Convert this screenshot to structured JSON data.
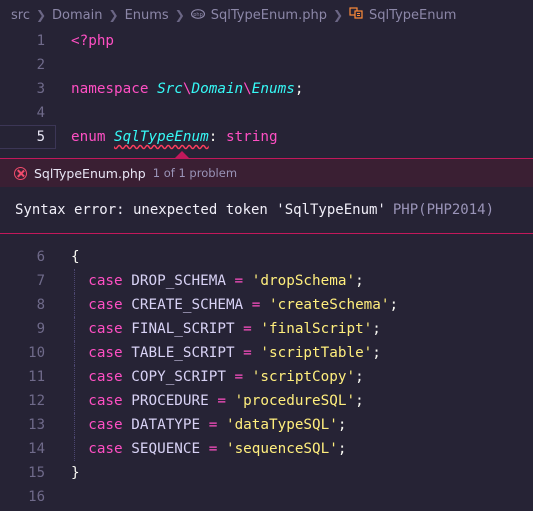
{
  "breadcrumb": {
    "items": [
      "src",
      "Domain",
      "Enums",
      "SqlTypeEnum.php",
      "SqlTypeEnum"
    ]
  },
  "editor_top": [
    {
      "n": "1",
      "tokens": [
        {
          "t": "<?php",
          "c": "tag"
        }
      ]
    },
    {
      "n": "2",
      "tokens": []
    },
    {
      "n": "3",
      "tokens": [
        {
          "t": "namespace ",
          "c": "kw"
        },
        {
          "t": "Src",
          "c": "ns"
        },
        {
          "t": "\\",
          "c": "sep"
        },
        {
          "t": "Domain",
          "c": "ns"
        },
        {
          "t": "\\",
          "c": "sep"
        },
        {
          "t": "Enums",
          "c": "ns"
        },
        {
          "t": ";",
          "c": "plain"
        }
      ]
    },
    {
      "n": "4",
      "tokens": []
    },
    {
      "n": "5",
      "active": true,
      "tokens": [
        {
          "t": "enum ",
          "c": "kw"
        },
        {
          "t": "SqlTypeEnum",
          "c": "cls squig"
        },
        {
          "t": ":",
          "c": "plain"
        },
        {
          "t": " string",
          "c": "type"
        }
      ]
    }
  ],
  "problem_peek": {
    "file": "SqlTypeEnum.php",
    "count": "1 of 1 problem",
    "message": "Syntax error: unexpected token 'SqlTypeEnum'",
    "source": "PHP(PHP2014)"
  },
  "editor_bottom": [
    {
      "n": "6",
      "tokens": [
        {
          "t": "{",
          "c": "plain"
        }
      ]
    },
    {
      "n": "7",
      "guide": true,
      "tokens": [
        {
          "t": "  case ",
          "c": "kw"
        },
        {
          "t": "DROP_SCHEMA",
          "c": "const"
        },
        {
          "t": " = ",
          "c": "op"
        },
        {
          "t": "'dropSchema'",
          "c": "strg"
        },
        {
          "t": ";",
          "c": "plain"
        }
      ]
    },
    {
      "n": "8",
      "guide": true,
      "tokens": [
        {
          "t": "  case ",
          "c": "kw"
        },
        {
          "t": "CREATE_SCHEMA",
          "c": "const"
        },
        {
          "t": " = ",
          "c": "op"
        },
        {
          "t": "'createSchema'",
          "c": "strg"
        },
        {
          "t": ";",
          "c": "plain"
        }
      ]
    },
    {
      "n": "9",
      "guide": true,
      "tokens": [
        {
          "t": "  case ",
          "c": "kw"
        },
        {
          "t": "FINAL_SCRIPT",
          "c": "const"
        },
        {
          "t": " = ",
          "c": "op"
        },
        {
          "t": "'finalScript'",
          "c": "strg"
        },
        {
          "t": ";",
          "c": "plain"
        }
      ]
    },
    {
      "n": "10",
      "guide": true,
      "tokens": [
        {
          "t": "  case ",
          "c": "kw"
        },
        {
          "t": "TABLE_SCRIPT",
          "c": "const"
        },
        {
          "t": " = ",
          "c": "op"
        },
        {
          "t": "'scriptTable'",
          "c": "strg"
        },
        {
          "t": ";",
          "c": "plain"
        }
      ]
    },
    {
      "n": "11",
      "guide": true,
      "tokens": [
        {
          "t": "  case ",
          "c": "kw"
        },
        {
          "t": "COPY_SCRIPT",
          "c": "const"
        },
        {
          "t": " = ",
          "c": "op"
        },
        {
          "t": "'scriptCopy'",
          "c": "strg"
        },
        {
          "t": ";",
          "c": "plain"
        }
      ]
    },
    {
      "n": "12",
      "guide": true,
      "tokens": [
        {
          "t": "  case ",
          "c": "kw"
        },
        {
          "t": "PROCEDURE",
          "c": "const"
        },
        {
          "t": " = ",
          "c": "op"
        },
        {
          "t": "'procedureSQL'",
          "c": "strg"
        },
        {
          "t": ";",
          "c": "plain"
        }
      ]
    },
    {
      "n": "13",
      "guide": true,
      "tokens": [
        {
          "t": "  case ",
          "c": "kw"
        },
        {
          "t": "DATATYPE",
          "c": "const"
        },
        {
          "t": " = ",
          "c": "op"
        },
        {
          "t": "'dataTypeSQL'",
          "c": "strg"
        },
        {
          "t": ";",
          "c": "plain"
        }
      ]
    },
    {
      "n": "14",
      "guide": true,
      "tokens": [
        {
          "t": "  case ",
          "c": "kw"
        },
        {
          "t": "SEQUENCE",
          "c": "const"
        },
        {
          "t": " = ",
          "c": "op"
        },
        {
          "t": "'sequenceSQL'",
          "c": "strg"
        },
        {
          "t": ";",
          "c": "plain"
        }
      ]
    },
    {
      "n": "15",
      "tokens": [
        {
          "t": "}",
          "c": "plain"
        }
      ]
    },
    {
      "n": "16",
      "tokens": []
    }
  ]
}
